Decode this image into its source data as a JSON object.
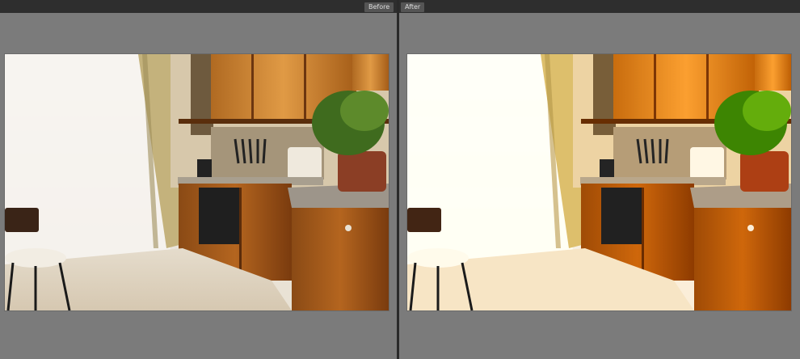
{
  "window": {
    "background": "#7b7b7b",
    "divider": "#2a2a2a"
  },
  "panels": [
    {
      "label": "Before",
      "image": "kitchen-photo-before"
    },
    {
      "label": "After",
      "image": "kitchen-photo-after"
    }
  ]
}
